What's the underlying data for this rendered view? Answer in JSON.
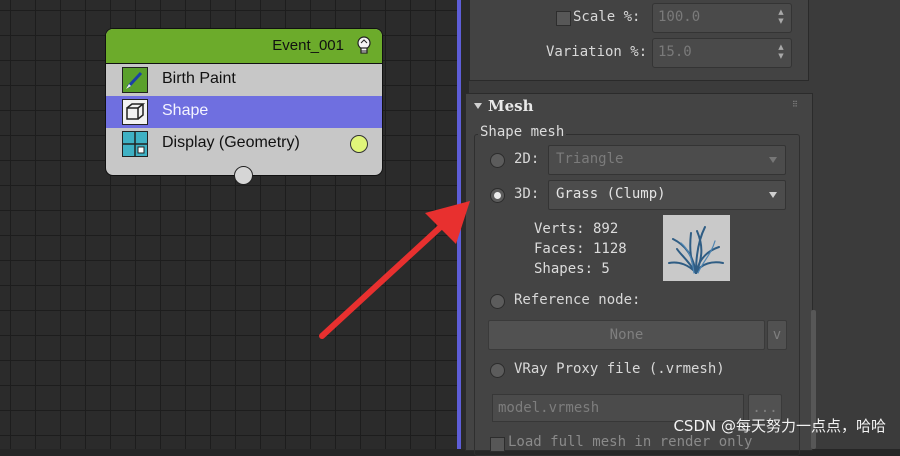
{
  "node_graph": {
    "event_title": "Event_001",
    "operators": [
      {
        "label": "Birth Paint",
        "icon": "paint-brush-icon"
      },
      {
        "label": "Shape",
        "icon": "cube-icon",
        "selected": true
      },
      {
        "label": "Display (Geometry)",
        "icon": "display-grid-icon"
      }
    ],
    "header_color": "#6cab2b",
    "selected_color": "#6f6fe0"
  },
  "panel": {
    "scale": {
      "label": "Scale %:",
      "value": "100.0",
      "checked": false
    },
    "variation": {
      "label": "Variation %:",
      "value": "15.0"
    },
    "mesh": {
      "title": "Mesh",
      "group_title": "Shape mesh",
      "mode_2d": {
        "label": "2D:",
        "value": "Triangle",
        "selected": false
      },
      "mode_3d": {
        "label": "3D:",
        "value": "Grass (Clump)",
        "selected": true
      },
      "stats": {
        "verts": "Verts: 892",
        "faces": "Faces: 1128",
        "shapes": "Shapes: 5"
      },
      "thumbnail_icon": "grass-clump-preview-icon",
      "reference_node": {
        "label": "Reference node:",
        "button": "None",
        "pick_button": "v"
      },
      "vray_proxy": {
        "label": "VRay Proxy file (.vrmesh)",
        "file": "model.vrmesh",
        "browse_button": "..."
      },
      "load_full": {
        "label": "Load full mesh in render only"
      }
    }
  },
  "watermark": "CSDN @每天努力一点点，哈哈",
  "annotation_color": "#e8302f"
}
